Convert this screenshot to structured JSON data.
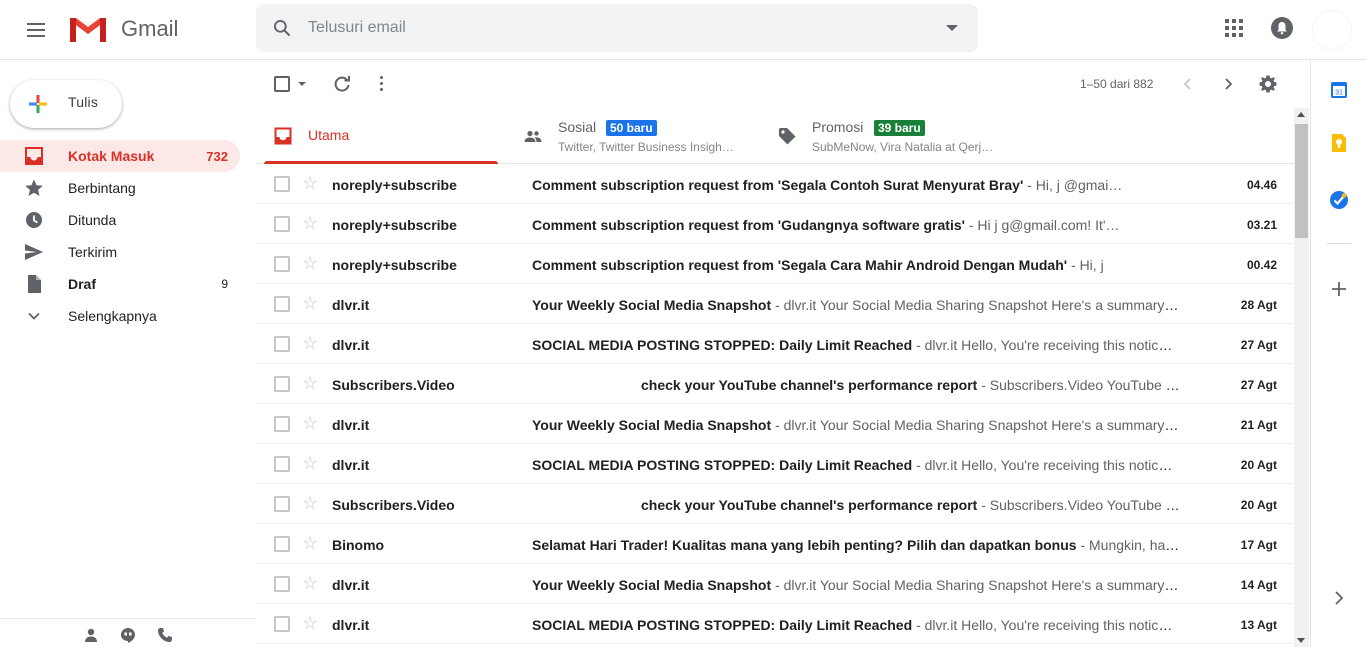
{
  "app": {
    "brand": "Gmail"
  },
  "search": {
    "placeholder": "Telusuri email"
  },
  "compose": {
    "label": "Tulis"
  },
  "nav": [
    {
      "label": "Kotak Masuk",
      "count": "732",
      "icon": "inbox-icon"
    },
    {
      "label": "Berbintang",
      "count": "",
      "icon": "star-icon"
    },
    {
      "label": "Ditunda",
      "count": "",
      "icon": "clock-icon"
    },
    {
      "label": "Terkirim",
      "count": "",
      "icon": "send-icon"
    },
    {
      "label": "Draf",
      "count": "9",
      "icon": "draft-icon"
    },
    {
      "label": "Selengkapnya",
      "count": "",
      "icon": "chevron-down-icon"
    }
  ],
  "toolbar": {
    "pager": "1–50 dari 882"
  },
  "tabs": [
    {
      "name": "Utama",
      "badge": "",
      "sub": ""
    },
    {
      "name": "Sosial",
      "badge": "50 baru",
      "sub": "Twitter, Twitter Business Insigh…",
      "badge_color": "#1a73e8"
    },
    {
      "name": "Promosi",
      "badge": "39 baru",
      "sub": "SubMeNow, Vira Natalia at Qerj…",
      "badge_color": "#188038"
    }
  ],
  "emails": [
    {
      "from": "noreply+subscribe",
      "subject": "Comment subscription request from 'Segala Contoh Surat Menyurat Bray'",
      "snippet": "Hi, j                     @gmai…",
      "date": "04.46"
    },
    {
      "from": "noreply+subscribe",
      "subject": "Comment subscription request from 'Gudangnya software gratis'",
      "snippet": "Hi j                   g@gmail.com! It'…",
      "date": "03.21"
    },
    {
      "from": "noreply+subscribe",
      "subject": "Comment subscription request from 'Segala Cara Mahir Android Dengan Mudah'",
      "snippet": "Hi, j",
      "date": "00.42"
    },
    {
      "from": "dlvr.it",
      "subject": "Your Weekly Social Media Snapshot",
      "snippet": "dlvr.it Your Social Media Sharing Snapshot Here's a summary …",
      "date": "28 Agt"
    },
    {
      "from": "dlvr.it",
      "subject": "SOCIAL MEDIA POSTING STOPPED: Daily Limit Reached",
      "snippet": "dlvr.it Hello, You're receiving this notice b…",
      "date": "27 Agt"
    },
    {
      "from": "Subscribers.Video",
      "subject": "check your YouTube channel's performance report",
      "snippet": "Subscribers.Video YouTube S…",
      "date": "27 Agt",
      "redacted_prefix": true
    },
    {
      "from": "dlvr.it",
      "subject": "Your Weekly Social Media Snapshot",
      "snippet": "dlvr.it Your Social Media Sharing Snapshot Here's a summary …",
      "date": "21 Agt"
    },
    {
      "from": "dlvr.it",
      "subject": "SOCIAL MEDIA POSTING STOPPED: Daily Limit Reached",
      "snippet": "dlvr.it Hello, You're receiving this notice b…",
      "date": "20 Agt"
    },
    {
      "from": "Subscribers.Video",
      "subject": "check your YouTube channel's performance report",
      "snippet": "Subscribers.Video YouTube S…",
      "date": "20 Agt",
      "redacted_prefix": true
    },
    {
      "from": "Binomo",
      "subject": "Selamat Hari Trader! Kualitas mana yang lebih penting? Pilih dan dapatkan bonus",
      "snippet": "Mungkin, hal ya…",
      "date": "17 Agt"
    },
    {
      "from": "dlvr.it",
      "subject": "Your Weekly Social Media Snapshot",
      "snippet": "dlvr.it Your Social Media Sharing Snapshot Here's a summary …",
      "date": "14 Agt"
    },
    {
      "from": "dlvr.it",
      "subject": "SOCIAL MEDIA POSTING STOPPED: Daily Limit Reached",
      "snippet": "dlvr.it Hello, You're receiving this notice b…",
      "date": "13 Agt"
    }
  ],
  "addons": [
    {
      "icon": "calendar-icon",
      "text": "31"
    },
    {
      "icon": "keep-icon"
    },
    {
      "icon": "tasks-icon"
    },
    {
      "icon": "add-addon-icon"
    }
  ],
  "colors": {
    "accent_red": "#d93025",
    "social_badge": "#1a73e8",
    "promo_badge": "#188038"
  }
}
